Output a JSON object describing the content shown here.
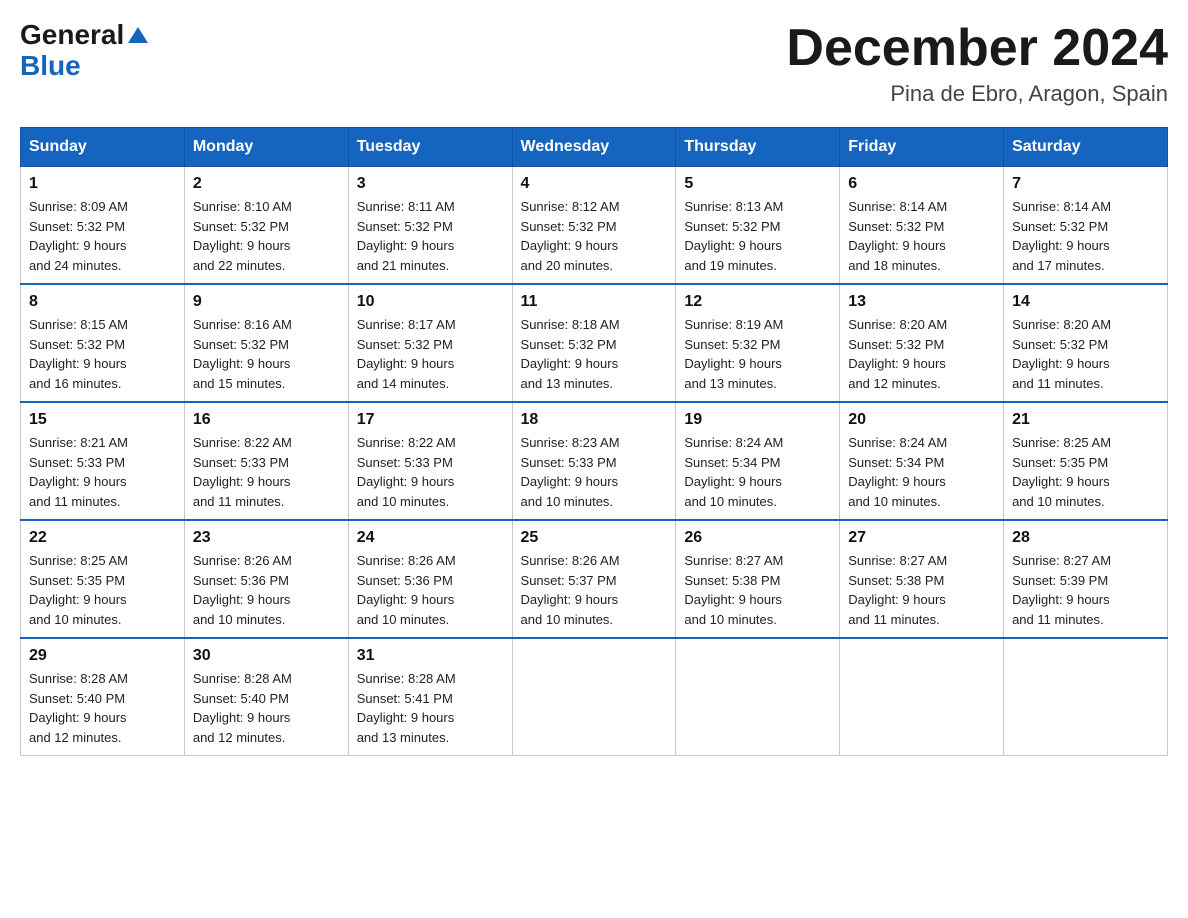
{
  "header": {
    "logo": {
      "general_text": "General",
      "blue_text": "Blue"
    },
    "title": "December 2024",
    "location": "Pina de Ebro, Aragon, Spain"
  },
  "weekdays": [
    "Sunday",
    "Monday",
    "Tuesday",
    "Wednesday",
    "Thursday",
    "Friday",
    "Saturday"
  ],
  "weeks": [
    [
      {
        "day": "1",
        "sunrise": "8:09 AM",
        "sunset": "5:32 PM",
        "daylight": "9 hours and 24 minutes."
      },
      {
        "day": "2",
        "sunrise": "8:10 AM",
        "sunset": "5:32 PM",
        "daylight": "9 hours and 22 minutes."
      },
      {
        "day": "3",
        "sunrise": "8:11 AM",
        "sunset": "5:32 PM",
        "daylight": "9 hours and 21 minutes."
      },
      {
        "day": "4",
        "sunrise": "8:12 AM",
        "sunset": "5:32 PM",
        "daylight": "9 hours and 20 minutes."
      },
      {
        "day": "5",
        "sunrise": "8:13 AM",
        "sunset": "5:32 PM",
        "daylight": "9 hours and 19 minutes."
      },
      {
        "day": "6",
        "sunrise": "8:14 AM",
        "sunset": "5:32 PM",
        "daylight": "9 hours and 18 minutes."
      },
      {
        "day": "7",
        "sunrise": "8:14 AM",
        "sunset": "5:32 PM",
        "daylight": "9 hours and 17 minutes."
      }
    ],
    [
      {
        "day": "8",
        "sunrise": "8:15 AM",
        "sunset": "5:32 PM",
        "daylight": "9 hours and 16 minutes."
      },
      {
        "day": "9",
        "sunrise": "8:16 AM",
        "sunset": "5:32 PM",
        "daylight": "9 hours and 15 minutes."
      },
      {
        "day": "10",
        "sunrise": "8:17 AM",
        "sunset": "5:32 PM",
        "daylight": "9 hours and 14 minutes."
      },
      {
        "day": "11",
        "sunrise": "8:18 AM",
        "sunset": "5:32 PM",
        "daylight": "9 hours and 13 minutes."
      },
      {
        "day": "12",
        "sunrise": "8:19 AM",
        "sunset": "5:32 PM",
        "daylight": "9 hours and 13 minutes."
      },
      {
        "day": "13",
        "sunrise": "8:20 AM",
        "sunset": "5:32 PM",
        "daylight": "9 hours and 12 minutes."
      },
      {
        "day": "14",
        "sunrise": "8:20 AM",
        "sunset": "5:32 PM",
        "daylight": "9 hours and 11 minutes."
      }
    ],
    [
      {
        "day": "15",
        "sunrise": "8:21 AM",
        "sunset": "5:33 PM",
        "daylight": "9 hours and 11 minutes."
      },
      {
        "day": "16",
        "sunrise": "8:22 AM",
        "sunset": "5:33 PM",
        "daylight": "9 hours and 11 minutes."
      },
      {
        "day": "17",
        "sunrise": "8:22 AM",
        "sunset": "5:33 PM",
        "daylight": "9 hours and 10 minutes."
      },
      {
        "day": "18",
        "sunrise": "8:23 AM",
        "sunset": "5:33 PM",
        "daylight": "9 hours and 10 minutes."
      },
      {
        "day": "19",
        "sunrise": "8:24 AM",
        "sunset": "5:34 PM",
        "daylight": "9 hours and 10 minutes."
      },
      {
        "day": "20",
        "sunrise": "8:24 AM",
        "sunset": "5:34 PM",
        "daylight": "9 hours and 10 minutes."
      },
      {
        "day": "21",
        "sunrise": "8:25 AM",
        "sunset": "5:35 PM",
        "daylight": "9 hours and 10 minutes."
      }
    ],
    [
      {
        "day": "22",
        "sunrise": "8:25 AM",
        "sunset": "5:35 PM",
        "daylight": "9 hours and 10 minutes."
      },
      {
        "day": "23",
        "sunrise": "8:26 AM",
        "sunset": "5:36 PM",
        "daylight": "9 hours and 10 minutes."
      },
      {
        "day": "24",
        "sunrise": "8:26 AM",
        "sunset": "5:36 PM",
        "daylight": "9 hours and 10 minutes."
      },
      {
        "day": "25",
        "sunrise": "8:26 AM",
        "sunset": "5:37 PM",
        "daylight": "9 hours and 10 minutes."
      },
      {
        "day": "26",
        "sunrise": "8:27 AM",
        "sunset": "5:38 PM",
        "daylight": "9 hours and 10 minutes."
      },
      {
        "day": "27",
        "sunrise": "8:27 AM",
        "sunset": "5:38 PM",
        "daylight": "9 hours and 11 minutes."
      },
      {
        "day": "28",
        "sunrise": "8:27 AM",
        "sunset": "5:39 PM",
        "daylight": "9 hours and 11 minutes."
      }
    ],
    [
      {
        "day": "29",
        "sunrise": "8:28 AM",
        "sunset": "5:40 PM",
        "daylight": "9 hours and 12 minutes."
      },
      {
        "day": "30",
        "sunrise": "8:28 AM",
        "sunset": "5:40 PM",
        "daylight": "9 hours and 12 minutes."
      },
      {
        "day": "31",
        "sunrise": "8:28 AM",
        "sunset": "5:41 PM",
        "daylight": "9 hours and 13 minutes."
      },
      null,
      null,
      null,
      null
    ]
  ],
  "labels": {
    "sunrise": "Sunrise:",
    "sunset": "Sunset:",
    "daylight": "Daylight:"
  }
}
